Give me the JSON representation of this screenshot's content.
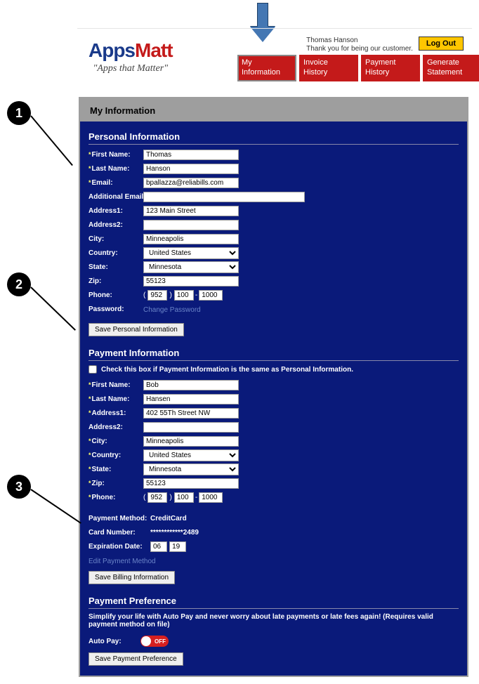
{
  "header": {
    "logo_apps": "Apps",
    "logo_matt": "Matt",
    "logo_tag": "\"Apps that Matter\"",
    "user_name": "Thomas Hanson",
    "user_thanks": "Thank you for being our customer.",
    "logout": "Log Out"
  },
  "nav": {
    "tabs": [
      {
        "l1": "My",
        "l2": "Information"
      },
      {
        "l1": "Invoice",
        "l2": "History"
      },
      {
        "l1": "Payment",
        "l2": "History"
      },
      {
        "l1": "Generate",
        "l2": "Statement"
      }
    ]
  },
  "callouts": {
    "b1": "1",
    "b2": "2",
    "b3": "3"
  },
  "page": {
    "title": "My Information"
  },
  "personal": {
    "header": "Personal Information",
    "labels": {
      "first": "First Name:",
      "last": "Last Name:",
      "email": "Email:",
      "addl": "Additional Emails:",
      "addr1": "Address1:",
      "addr2": "Address2:",
      "city": "City:",
      "country": "Country:",
      "state": "State:",
      "zip": "Zip:",
      "phone": "Phone:",
      "password": "Password:"
    },
    "values": {
      "first": "Thomas",
      "last": "Hanson",
      "email": "bpallazza@reliabills.com",
      "addl": "",
      "addr1": "123 Main Street",
      "addr2": "",
      "city": "Minneapolis",
      "country": "United States",
      "state": "Minnesota",
      "zip": "55123",
      "phone_a": "952",
      "phone_b": "100",
      "phone_c": "1000"
    },
    "change_pw": "Change Password",
    "save": "Save Personal Information"
  },
  "payment": {
    "header": "Payment Information",
    "same_label": "Check this box if Payment Information is the same as Personal Information.",
    "labels": {
      "first": "First Name:",
      "last": "Last Name:",
      "addr1": "Address1:",
      "addr2": "Address2:",
      "city": "City:",
      "country": "Country:",
      "state": "State:",
      "zip": "Zip:",
      "phone": "Phone:",
      "method": "Payment Method:",
      "card": "Card Number:",
      "exp": "Expiration Date:"
    },
    "values": {
      "first": "Bob",
      "last": "Hansen",
      "addr1": "402 55Th Street NW",
      "addr2": "",
      "city": "Minneapolis",
      "country": "United States",
      "state": "Minnesota",
      "zip": "55123",
      "phone_a": "952",
      "phone_b": "100",
      "phone_c": "1000",
      "method": "CreditCard",
      "card": "************2489",
      "exp_m": "06",
      "exp_y": "19"
    },
    "edit": "Edit Payment Method",
    "save": "Save Billing Information"
  },
  "pref": {
    "header": "Payment Preference",
    "note": "Simplify your life with Auto Pay and never worry about late payments or late fees again! (Requires valid payment method on file)",
    "autopay_label": "Auto Pay:",
    "toggle_state": "OFF",
    "save": "Save Payment Preference"
  }
}
